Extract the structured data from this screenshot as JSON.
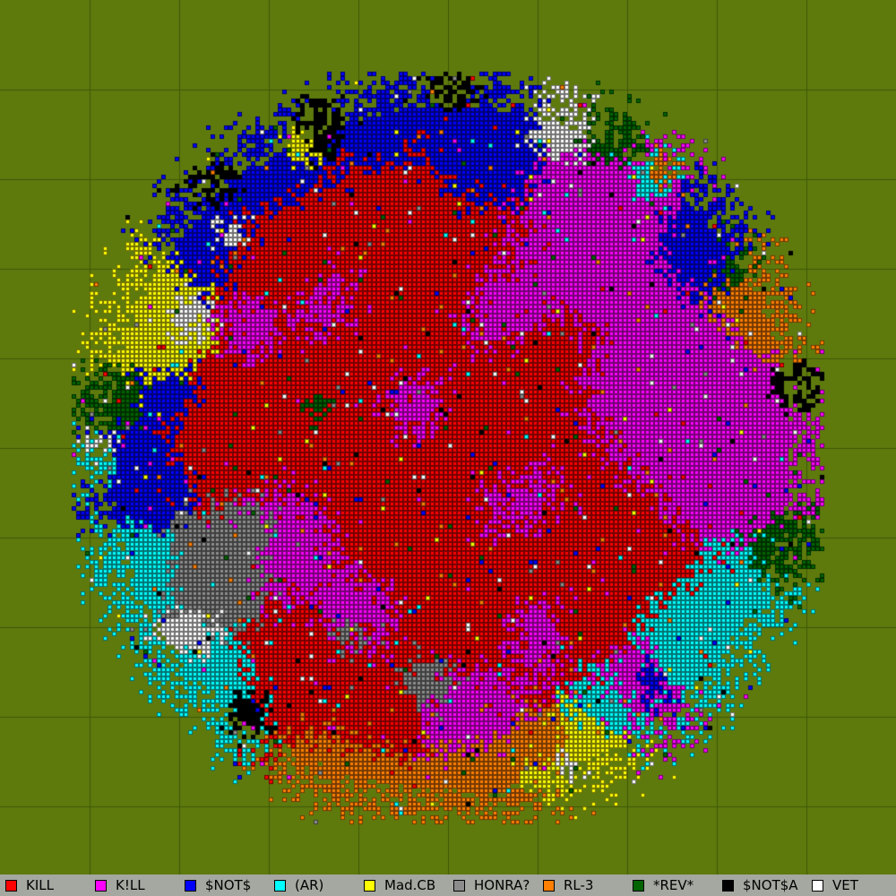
{
  "map": {
    "background_color": "#5e7a0d",
    "grid_color": "#3f5708",
    "cell_border_color": "#000000"
  },
  "legend": {
    "background_color": "#a4a8a0",
    "teams": [
      {
        "label": "KILL",
        "color": "#ff0000"
      },
      {
        "label": "K!LL",
        "color": "#ff00ff"
      },
      {
        "label": "$NOT$",
        "color": "#0000ff"
      },
      {
        "label": "(AR)",
        "color": "#00ffff"
      },
      {
        "label": "Mad.CB",
        "color": "#ffff00"
      },
      {
        "label": "HONRA?",
        "color": "#8c8c8c"
      },
      {
        "label": "RL-3",
        "color": "#ff7f00"
      },
      {
        "label": "*REV*",
        "color": "#006400"
      },
      {
        "label": "$NOT$A",
        "color": "#000000"
      },
      {
        "label": "VET",
        "color": "#ffffff"
      }
    ]
  }
}
